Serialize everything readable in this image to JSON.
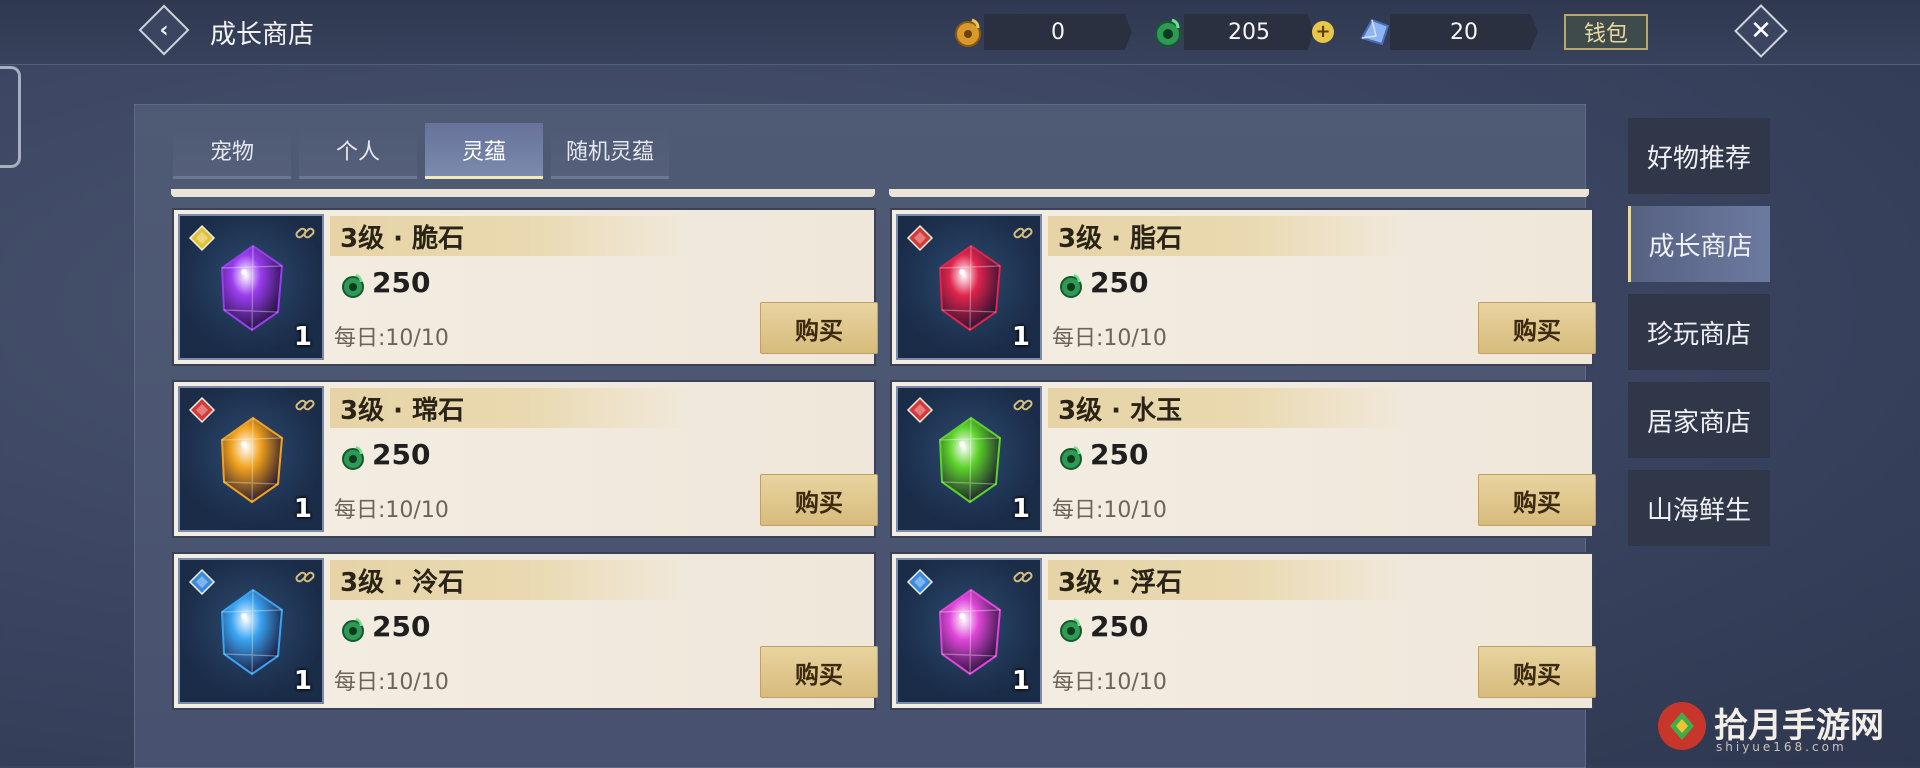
{
  "header": {
    "title": "成长商店",
    "currencies": [
      {
        "name": "gold-coin",
        "value": "0"
      },
      {
        "name": "jade-coin",
        "value": "205"
      },
      {
        "name": "crystal",
        "value": "20"
      }
    ],
    "wallet_label": "钱包"
  },
  "tabs": [
    {
      "label": "宠物",
      "active": false
    },
    {
      "label": "个人",
      "active": false
    },
    {
      "label": "灵蕴",
      "active": true
    },
    {
      "label": "随机灵蕴",
      "active": false
    }
  ],
  "items": [
    {
      "name": "3级 · 脆石",
      "price": "250",
      "daily": "每日:10/10",
      "qty": "1",
      "buy_label": "购买",
      "gem_color": "#9a3cf0",
      "badge_color": "#e0c23a"
    },
    {
      "name": "3级 · 脂石",
      "price": "250",
      "daily": "每日:10/10",
      "qty": "1",
      "buy_label": "购买",
      "gem_color": "#e0244c",
      "badge_color": "#d43a3a"
    },
    {
      "name": "3级 · 瑺石",
      "price": "250",
      "daily": "每日:10/10",
      "qty": "1",
      "buy_label": "购买",
      "gem_color": "#f2a21e",
      "badge_color": "#d43a3a"
    },
    {
      "name": "3级 · 水玉",
      "price": "250",
      "daily": "每日:10/10",
      "qty": "1",
      "buy_label": "购买",
      "gem_color": "#5cd22a",
      "badge_color": "#d43a3a"
    },
    {
      "name": "3级 · 泠石",
      "price": "250",
      "daily": "每日:10/10",
      "qty": "1",
      "buy_label": "购买",
      "gem_color": "#3aa4f2",
      "badge_color": "#3a8ae0"
    },
    {
      "name": "3级 · 浮石",
      "price": "250",
      "daily": "每日:10/10",
      "qty": "1",
      "buy_label": "购买",
      "gem_color": "#e046d8",
      "badge_color": "#3a8ae0"
    }
  ],
  "side_nav": [
    {
      "label": "好物推荐",
      "active": false
    },
    {
      "label": "成长商店",
      "active": true
    },
    {
      "label": "珍玩商店",
      "active": false
    },
    {
      "label": "居家商店",
      "active": false
    },
    {
      "label": "山海鲜生",
      "active": false
    }
  ],
  "watermark": {
    "text": "拾月手游网",
    "sub": "shiyue168.com"
  }
}
